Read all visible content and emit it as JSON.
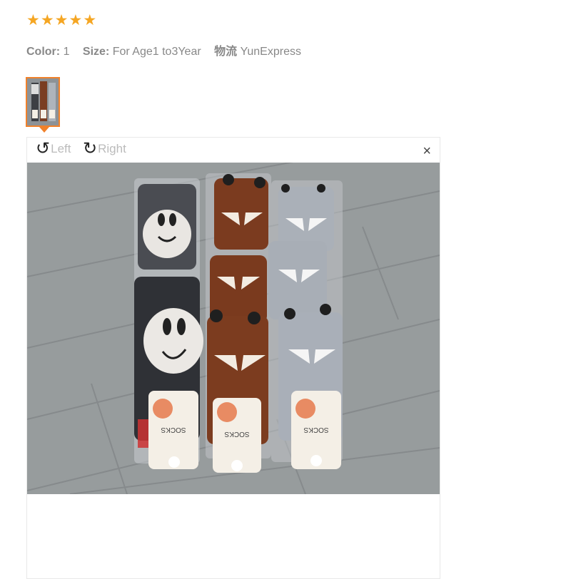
{
  "rating": {
    "stars": [
      "★",
      "★",
      "★",
      "★",
      "★"
    ],
    "color": "#f5a623"
  },
  "props": {
    "color_label": "Color:",
    "color_value": "1",
    "size_label": "Size:",
    "size_value": "For Age1 to3Year",
    "shipping_label": "物流",
    "shipping_value": "YunExpress"
  },
  "viewer": {
    "rotate_left_label": "Left",
    "rotate_right_label": "Right",
    "close_symbol": "×"
  },
  "photo": {
    "tag_text": "SOCKS"
  },
  "accent_color": "#f0812b"
}
